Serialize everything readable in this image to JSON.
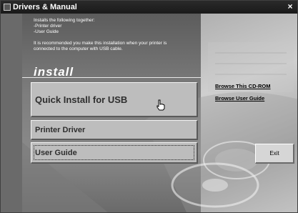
{
  "window": {
    "title": "Drivers & Manual",
    "close_glyph": "×"
  },
  "info": {
    "lines": [
      "Installs the following together:",
      "-Printer driver",
      "-User Guide",
      "",
      "It is recommended you make this installation when your printer is",
      "connected to the computer with USB cable."
    ]
  },
  "section": {
    "heading": "install"
  },
  "buttons": {
    "quick_install": "Quick Install for USB",
    "printer_driver": "Printer Driver",
    "user_guide": "User Guide",
    "exit": "Exit"
  },
  "links": {
    "browse_cd": "Browse This CD-ROM",
    "browse_guide": "Browse User Guide"
  },
  "icons": {
    "app": "app-icon",
    "close": "close-icon",
    "cursor": "hand-pointer-icon"
  }
}
